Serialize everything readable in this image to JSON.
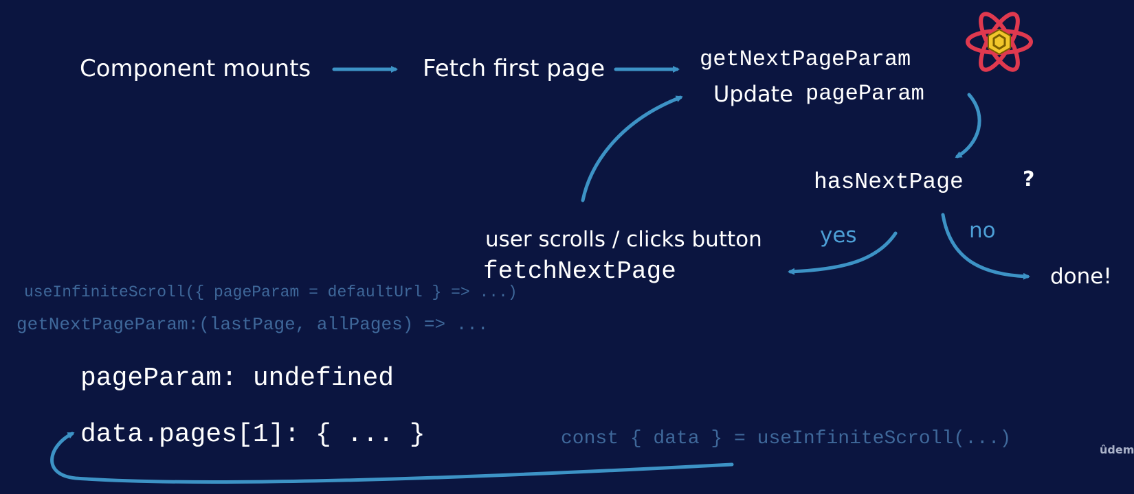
{
  "flow": {
    "component_mounts": "Component mounts",
    "fetch_first_page": "Fetch first page",
    "get_next_page_param": "getNextPageParam",
    "update_word": "Update",
    "page_param": "pageParam",
    "has_next_page": "hasNextPage",
    "question_mark": "?",
    "yes": "yes",
    "no": "no",
    "done": "done!",
    "user_scrolls": "user scrolls / clicks button",
    "fetch_next_page": "fetchNextPage"
  },
  "code": {
    "use_infinite_scroll_signature": "useInfiniteScroll({ pageParam = defaultUrl } => ...)",
    "get_next_page_param_signature": "getNextPageParam:(lastPage, allPages) => ...",
    "page_param_value": "pageParam: undefined",
    "data_pages_value": "data.pages[1]: { ... }",
    "const_data": "const { data } = useInfiniteScroll(...)"
  },
  "watermark": "ûdemy",
  "colors": {
    "background": "#0b1540",
    "arrow": "#3d93c6",
    "accent_text": "#4d9fd6",
    "dim_code": "#3f689a",
    "logo_red": "#e0394f",
    "logo_yellow": "#f2c62b"
  },
  "icons": [
    "react-query-logo-icon"
  ]
}
